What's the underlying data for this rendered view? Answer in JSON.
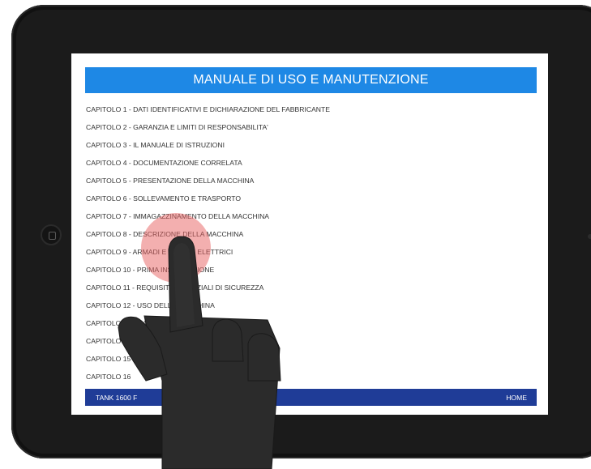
{
  "header": {
    "title": "MANUALE DI USO E MANUTENZIONE"
  },
  "chapters": [
    "CAPITOLO 1 - DATI IDENTIFICATIVI E DICHIARAZIONE DEL FABBRICANTE",
    "CAPITOLO 2 - GARANZIA E LIMITI DI RESPONSABILITA'",
    "CAPITOLO 3 - IL MANUALE DI ISTRUZIONI",
    "CAPITOLO 4 - DOCUMENTAZIONE CORRELATA",
    "CAPITOLO 5 - PRESENTAZIONE DELLA MACCHINA",
    "CAPITOLO 6 - SOLLEVAMENTO E TRASPORTO",
    "CAPITOLO 7 - IMMAGAZZINAMENTO DELLA MACCHINA",
    "CAPITOLO 8 - DESCRIZIONE DELLA MACCHINA",
    "CAPITOLO 9 - ARMADI E QUADRI ELETTRICI",
    "CAPITOLO 10 - PRIMA INSTALLAZIONE",
    "CAPITOLO 11 - REQUISITI ESSENZIALI DI SICUREZZA",
    "CAPITOLO 12 - USO DELLA MACCHINA",
    "CAPITOLO 13 - MANUTENZIONE PROGRAMMATA",
    "CAPITOLO 14 - MANUTENZIONE",
    "CAPITOLO 15 - MANUTENZIONE",
    "CAPITOLO 16"
  ],
  "footer": {
    "left_text": "TANK 1600 F",
    "home_label": "HOME"
  },
  "colors": {
    "header": "#1e88e5",
    "footer": "#1f3c97",
    "touch": "#e86060"
  }
}
